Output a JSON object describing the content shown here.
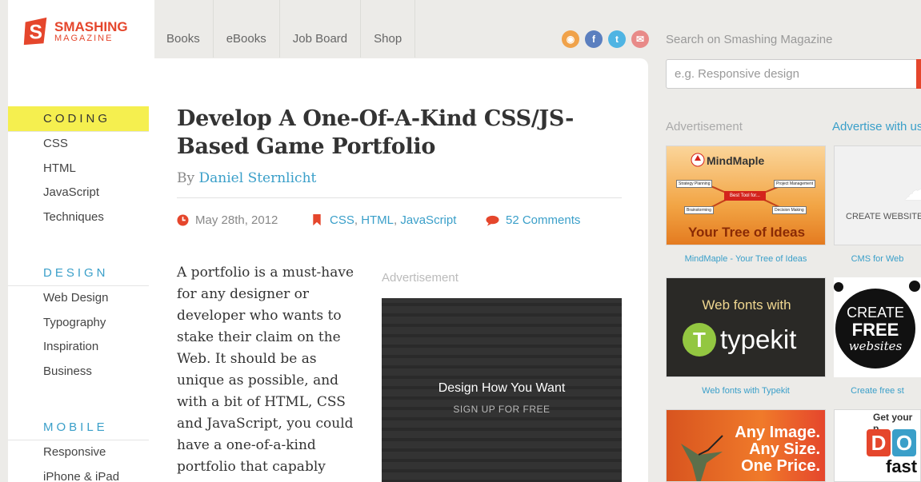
{
  "logo": {
    "line1": "SMASHING",
    "line2": "MAGAZINE"
  },
  "topnav": [
    "Books",
    "eBooks",
    "Job Board",
    "Shop"
  ],
  "social_icons": [
    {
      "name": "rss-icon",
      "color": "#f0a24a",
      "glyph": "◉"
    },
    {
      "name": "facebook-icon",
      "color": "#5b7fbf",
      "glyph": "f"
    },
    {
      "name": "twitter-icon",
      "color": "#4fb4e3",
      "glyph": "t"
    },
    {
      "name": "email-icon",
      "color": "#e88a88",
      "glyph": "✉"
    }
  ],
  "sidebar": {
    "coding": {
      "title": "CODING",
      "items": [
        "CSS",
        "HTML",
        "JavaScript",
        "Techniques"
      ]
    },
    "design": {
      "title": "DESIGN",
      "items": [
        "Web Design",
        "Typography",
        "Inspiration",
        "Business"
      ]
    },
    "mobile": {
      "title": "MOBILE",
      "items": [
        "Responsive",
        "iPhone & iPad"
      ]
    }
  },
  "article": {
    "title": "Develop A One-Of-A-Kind CSS/JS-Based Game Portfolio",
    "by": "By",
    "author": "Daniel Sternlicht",
    "date": "May 28th, 2012",
    "tags": [
      "CSS",
      "HTML",
      "JavaScript"
    ],
    "comments": "52 Comments",
    "body": "A portfolio is a must-have for any designer or developer who wants to stake their claim on the Web. It should be as unique as possible, and with a bit of HTML, CSS and JavaScript, you could have a one-of-a-kind portfolio that capably",
    "ad_label": "Advertisement",
    "ad_headline": "Design How You Want",
    "ad_cta": "SIGN UP FOR FREE"
  },
  "search": {
    "label": "Search on Smashing Magazine",
    "placeholder": "e.g. Responsive design"
  },
  "right": {
    "ad_label": "Advertisement",
    "advertise_link": "Advertise with us",
    "ads": [
      {
        "caption": "MindMaple - Your Tree of Ideas",
        "brand": "MindMaple",
        "tagline": "Your Tree of Ideas",
        "boxes": [
          "Strategy Planning",
          "Project Management",
          "Brainstorming",
          "Decision Making"
        ],
        "center": "Best Tool for..."
      },
      {
        "caption": "CMS for Web",
        "text": "CREATE WEBSITES"
      },
      {
        "caption": "Web fonts with Typekit",
        "line1": "Web fonts with",
        "word": "typekit"
      },
      {
        "caption": "Create free st",
        "a": "CREATE",
        "b": "FREE",
        "c": "websites"
      },
      {
        "line1": "Any Image.",
        "line2": "Any Size.",
        "line3": "One Price."
      },
      {
        "title": "Get your p",
        "letters": "DO",
        "fast": "fast"
      }
    ]
  }
}
